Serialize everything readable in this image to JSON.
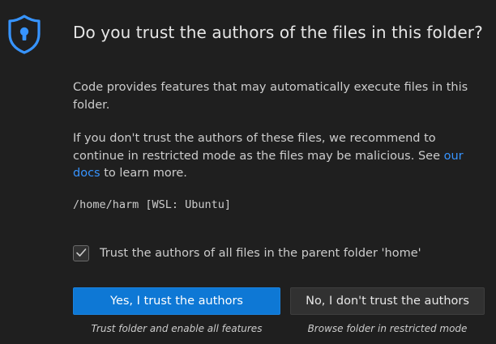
{
  "dialog": {
    "title": "Do you trust the authors of the files in this folder?",
    "message": "Code provides features that may automatically execute files in this folder.",
    "detail_before_link": "If you don't trust the authors of these files, we recommend to continue in restricted mode as the files may be malicious. See ",
    "detail_link": "our docs",
    "detail_after_link": " to learn more.",
    "folder_path": "/home/harm [WSL: Ubuntu]",
    "checkbox": {
      "label": "Trust the authors of all files in the parent folder 'home'",
      "checked": true
    },
    "buttons": {
      "trust": {
        "label": "Yes, I trust the authors",
        "caption": "Trust folder and enable all features"
      },
      "restrict": {
        "label": "No, I don't trust the authors",
        "caption": "Browse folder in restricted mode"
      }
    },
    "icon": "shield-lock-icon"
  },
  "colors": {
    "background": "#1f1f1f",
    "accent": "#0e78d5",
    "link": "#3794ff",
    "shield": "#3794ff"
  }
}
